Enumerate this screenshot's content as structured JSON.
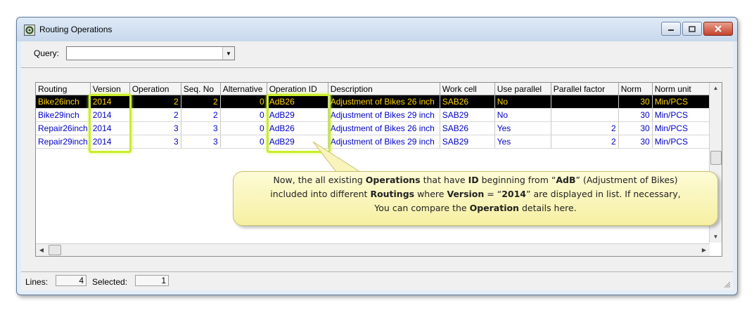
{
  "window": {
    "title": "Routing Operations"
  },
  "query": {
    "label": "Query:",
    "value": ""
  },
  "grid": {
    "columns": [
      "Routing",
      "Version",
      "Operation",
      "Seq. No",
      "Alternative",
      "Operation ID",
      "Description",
      "Work cell",
      "Use parallel",
      "Parallel factor",
      "Norm",
      "Norm unit"
    ],
    "rows": [
      [
        "Bike26inch",
        "2014",
        "2",
        "2",
        "0",
        "AdB26",
        "Adjustment of Bikes 26 inch",
        "SAB26",
        "No",
        "",
        "30",
        "Min/PCS"
      ],
      [
        "Bike29inch",
        "2014",
        "2",
        "2",
        "0",
        "AdB29",
        "Adjustment of Bikes 29 inch",
        "SAB29",
        "No",
        "",
        "30",
        "Min/PCS"
      ],
      [
        "Repair26inch",
        "2014",
        "3",
        "3",
        "0",
        "AdB26",
        "Adjustment of Bikes 26 inch",
        "SAB26",
        "Yes",
        "2",
        "30",
        "Min/PCS"
      ],
      [
        "Repair29inch",
        "2014",
        "3",
        "3",
        "0",
        "AdB29",
        "Adjustment of Bikes 29 inch",
        "SAB29",
        "Yes",
        "2",
        "30",
        "Min/PCS"
      ]
    ]
  },
  "callout": {
    "l1a": "Now, the all existing ",
    "l1b": "Operations",
    "l1c": " that have ",
    "l1d": "ID",
    "l1e": " beginning from “",
    "l1f": "AdB",
    "l1g": "” (Adjustment of Bikes)",
    "l2a": "included into different ",
    "l2b": "Routings",
    "l2c": " where ",
    "l2d": "Version",
    "l2e": " = “",
    "l2f": "2014",
    "l2g": "” are displayed in list. If necessary,",
    "l3a": "You can compare the ",
    "l3b": "Operation",
    "l3c": " details here."
  },
  "status": {
    "lines_label": "Lines:",
    "lines_value": "4",
    "selected_label": "Selected:",
    "selected_value": "1"
  },
  "colors": {
    "highlight": "#c8ee2a",
    "row_text": "#0000c8",
    "selected_bg": "#000000",
    "selected_text": "#ffd200"
  }
}
